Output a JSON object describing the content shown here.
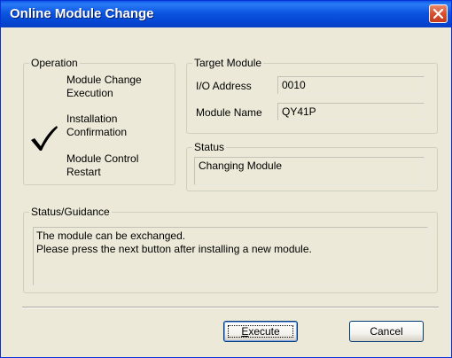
{
  "window": {
    "title": "Online Module Change"
  },
  "operation": {
    "legend": "Operation",
    "steps": [
      {
        "line1": "Module Change",
        "line2": "Execution"
      },
      {
        "line1": "Installation",
        "line2": "Confirmation"
      },
      {
        "line1": "Module Control",
        "line2": "Restart"
      }
    ],
    "current_step_icon": "checkmark-icon"
  },
  "target_module": {
    "legend": "Target Module",
    "io_address_label": "I/O Address",
    "io_address_value": "0010",
    "module_name_label": "Module Name",
    "module_name_value": "QY41P"
  },
  "status": {
    "legend": "Status",
    "value": "Changing Module"
  },
  "guidance": {
    "legend": "Status/Guidance",
    "line1": "The module can be exchanged.",
    "line2": "Please press the next button after installing a new module."
  },
  "buttons": {
    "execute_label": "Execute",
    "execute_mnemonic": "E",
    "execute_rest": "xecute",
    "cancel_label": "Cancel"
  },
  "colors": {
    "titlebar": "#0c55e0",
    "dialog_background": "#ece9d8",
    "close_button": "#d9502f"
  }
}
